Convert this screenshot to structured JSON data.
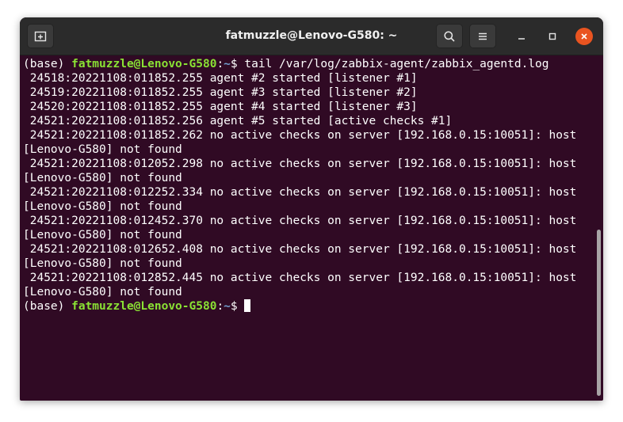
{
  "window": {
    "title": "fatmuzzle@Lenovo-G580: ~"
  },
  "titlebar_icons": {
    "new_tab": "new-tab-icon",
    "search": "search-icon",
    "menu": "hamburger-menu-icon",
    "minimize": "minimize-icon",
    "maximize": "maximize-icon",
    "close": "close-icon"
  },
  "colors": {
    "terminal_bg": "#300a24",
    "prompt_user": "#8ae234",
    "prompt_path": "#729fcf",
    "close_button": "#e95420"
  },
  "prompt": {
    "env": "(base) ",
    "user_host": "fatmuzzle@Lenovo-G580",
    "colon": ":",
    "path": "~",
    "dollar": "$ "
  },
  "command": "tail /var/log/zabbix-agent/zabbix_agentd.log",
  "output_lines": [
    " 24518:20221108:011852.255 agent #2 started [listener #1]",
    " 24519:20221108:011852.255 agent #3 started [listener #2]",
    " 24520:20221108:011852.255 agent #4 started [listener #3]",
    " 24521:20221108:011852.256 agent #5 started [active checks #1]",
    " 24521:20221108:011852.262 no active checks on server [192.168.0.15:10051]: host",
    "[Lenovo-G580] not found",
    " 24521:20221108:012052.298 no active checks on server [192.168.0.15:10051]: host",
    "[Lenovo-G580] not found",
    " 24521:20221108:012252.334 no active checks on server [192.168.0.15:10051]: host",
    "[Lenovo-G580] not found",
    " 24521:20221108:012452.370 no active checks on server [192.168.0.15:10051]: host",
    "[Lenovo-G580] not found",
    " 24521:20221108:012652.408 no active checks on server [192.168.0.15:10051]: host",
    "[Lenovo-G580] not found",
    " 24521:20221108:012852.445 no active checks on server [192.168.0.15:10051]: host",
    "[Lenovo-G580] not found"
  ]
}
